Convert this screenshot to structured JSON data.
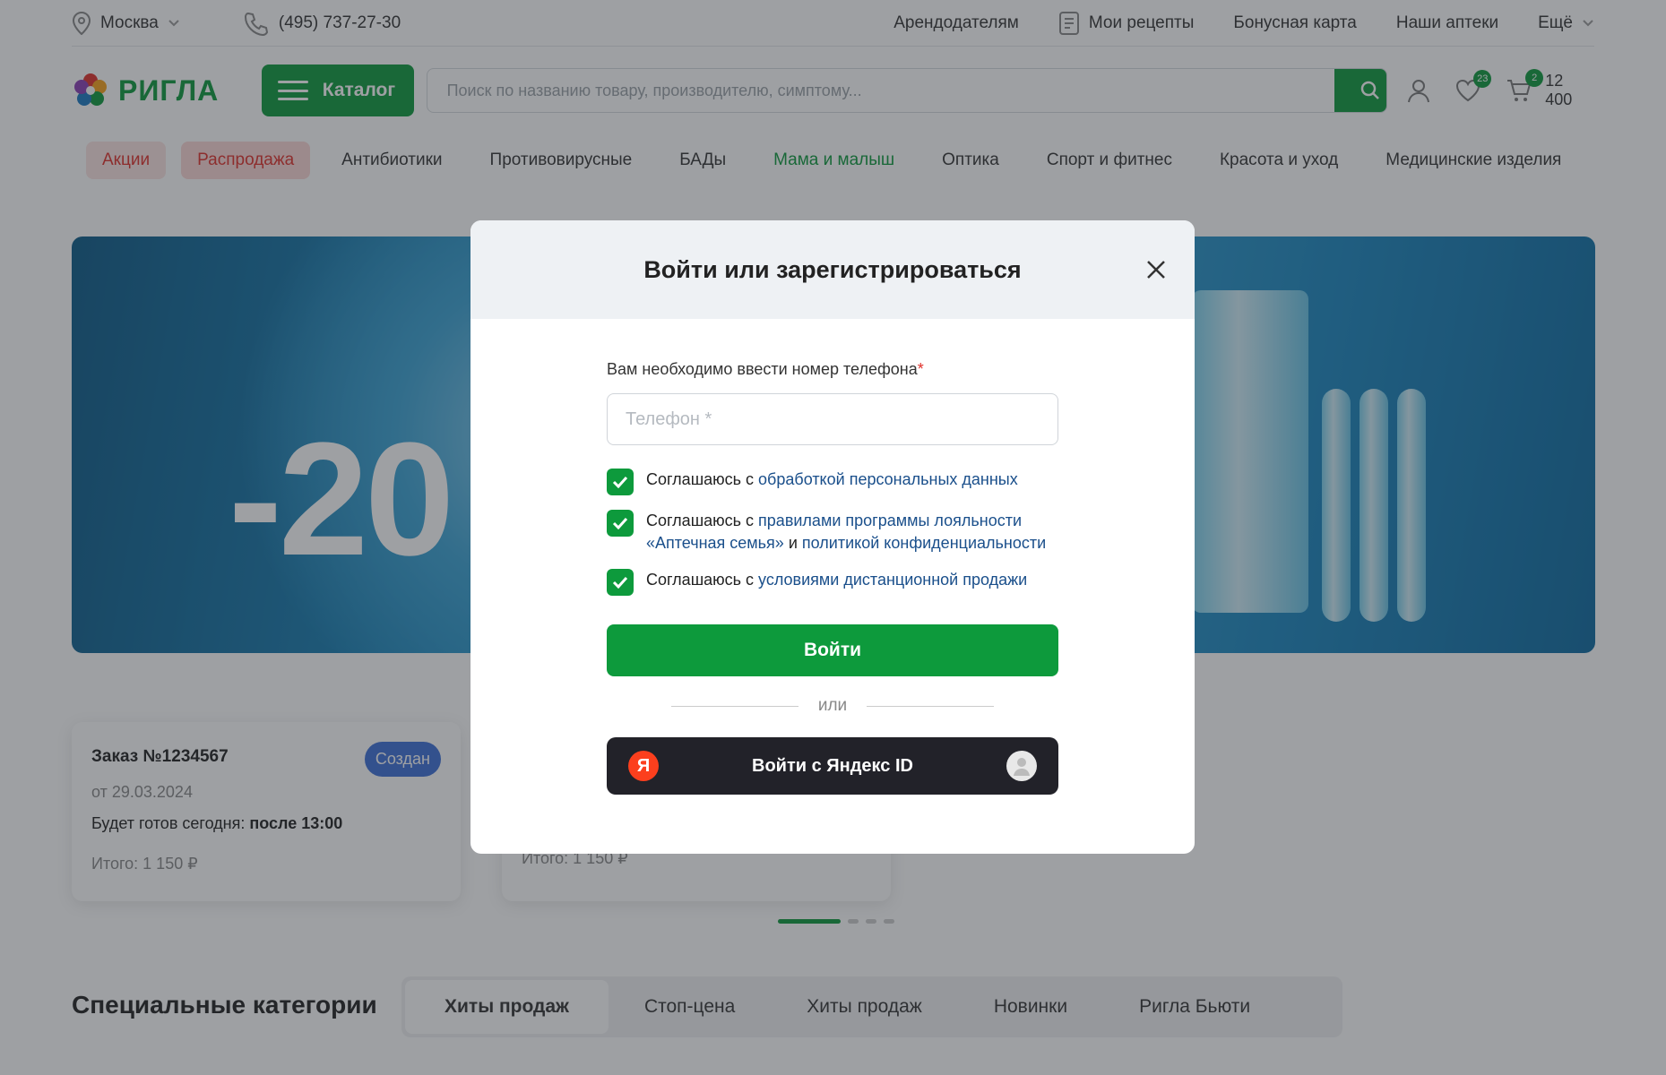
{
  "topbar": {
    "city": "Москва",
    "phone": "(495) 737-27-30",
    "links": [
      "Арендодателям",
      "Мои рецепты",
      "Бонусная карта",
      "Наши аптеки",
      "Ещё"
    ]
  },
  "header": {
    "logo_text": "РИГЛА",
    "catalog_label": "Каталог",
    "search_placeholder": "Поиск по названию товару, производителю, симптому...",
    "favorites_count": "23",
    "cart_count": "2",
    "cart_sum": "12 400"
  },
  "categories": [
    "Акции",
    "Распродажа",
    "Антибиотики",
    "Противовирусные",
    "БАДы",
    "Мама и малыш",
    "Оптика",
    "Спорт и фитнес",
    "Красота и уход",
    "Медицинские изделия"
  ],
  "banner": {
    "discount": "-20"
  },
  "orders": [
    {
      "title": "Заказ №1234567",
      "status": "Создан",
      "date": "от 29.03.2024",
      "ready_label": "Будет готов сегодня:",
      "ready_time": "после 13:00",
      "total": "Итого: 1 150 ₽"
    },
    {
      "total": "Итого: 1 150 ₽"
    }
  ],
  "special": {
    "title": "Специальные категории",
    "tabs": [
      "Хиты продаж",
      "Стоп-цена",
      "Хиты продаж",
      "Новинки",
      "Ригла Бьюти"
    ]
  },
  "modal": {
    "title": "Войти или зарегистрироваться",
    "phone_label": "Вам необходимо ввести номер телефона",
    "required_mark": "*",
    "phone_placeholder": "Телефон *",
    "agree_prefix": "Соглашаюсь с",
    "check1_link": "обработкой персональных данных",
    "check2_link1": "правилами программы лояльности «Аптечная семья»",
    "check2_and": "и",
    "check2_link2": "политикой конфиденциальности",
    "check3_link": "условиями дистанционной продажи",
    "login_label": "Войти",
    "or_label": "или",
    "yandex_label": "Войти с Яндекс ID",
    "yandex_logo": "Я"
  },
  "colors": {
    "brand_green": "#0d9a3c",
    "sale_red": "#e0312b",
    "status_blue": "#3d6fd7",
    "link_blue": "#1a4f8b"
  }
}
